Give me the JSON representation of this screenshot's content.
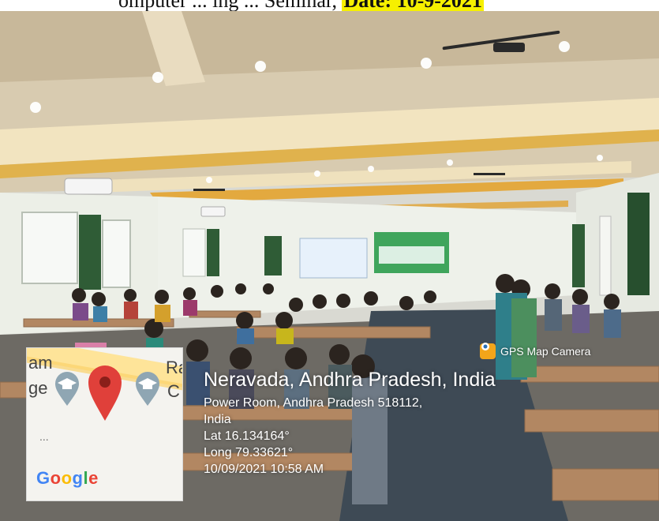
{
  "caption": {
    "partial_text": "omputer ... ing ... Seminar,",
    "date_label": "Date: 10-9-2021"
  },
  "photo": {
    "subject": "classroom seminar hall with students seated at benches",
    "banner_colors": [
      "#3aa15a",
      "#e6f3ff"
    ]
  },
  "map_card": {
    "text_left_top": "am",
    "text_left_mid": "ge",
    "text_right_top": "Ra",
    "text_right_mid": "C",
    "dots": "...",
    "google_letters": [
      "G",
      "o",
      "o",
      "g",
      "l",
      "e"
    ],
    "pin_color": "#e0403a",
    "cap_icon_color": "#8fa6b3"
  },
  "gps": {
    "app_label": "GPS Map Camera",
    "place": "Neravada, Andhra Pradesh, India",
    "address_line1": "Power Room, Andhra Pradesh 518112,",
    "address_line2": "India",
    "lat": "Lat 16.134164°",
    "long": "Long 79.33621°",
    "datetime": "10/09/2021 10:58 AM"
  }
}
